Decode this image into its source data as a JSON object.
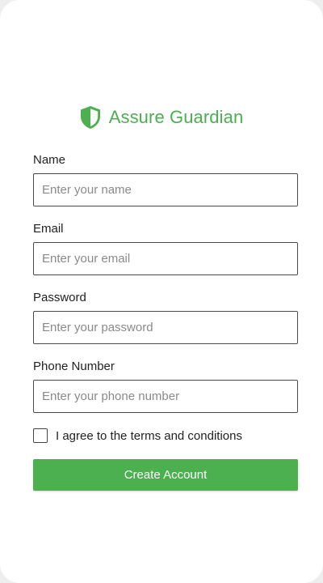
{
  "brand": {
    "name": "Assure Guardian",
    "icon": "shield-icon",
    "color": "#4caf50"
  },
  "form": {
    "name": {
      "label": "Name",
      "placeholder": "Enter your name",
      "value": ""
    },
    "email": {
      "label": "Email",
      "placeholder": "Enter your email",
      "value": ""
    },
    "password": {
      "label": "Password",
      "placeholder": "Enter your password",
      "value": ""
    },
    "phone": {
      "label": "Phone Number",
      "placeholder": "Enter your phone number",
      "value": ""
    },
    "terms": {
      "label": "I agree to the terms and conditions",
      "checked": false
    },
    "submit_label": "Create Account"
  },
  "colors": {
    "accent": "#4caf50",
    "text": "#222222",
    "placeholder": "#8a8a8a",
    "border": "#4a4a4a",
    "background": "#eeeeee",
    "card": "#ffffff"
  }
}
